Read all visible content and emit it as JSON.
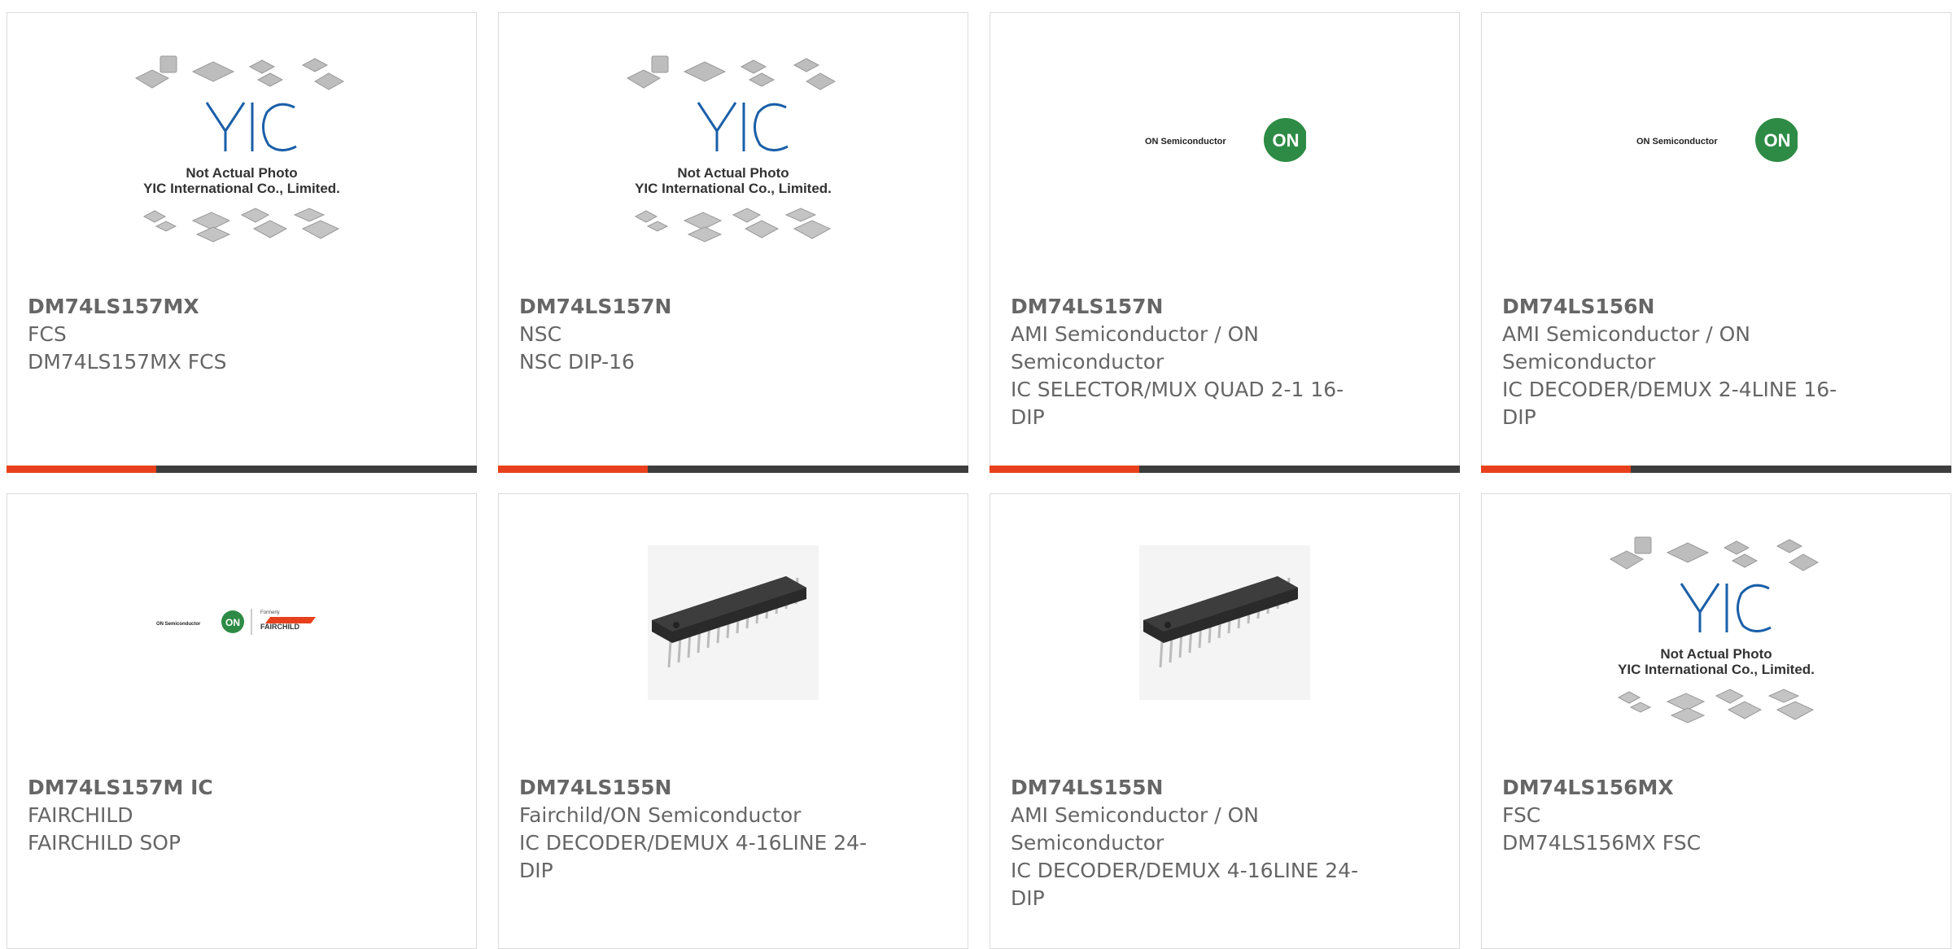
{
  "accent_color": "#e8401c",
  "bar_color": "#3d3d3d",
  "products": [
    {
      "part": "DM74LS157MX",
      "maker": "FCS",
      "desc": "DM74LS157MX FCS",
      "image": "yic-placeholder",
      "yic_line1": "Not Actual Photo",
      "yic_line2": "YIC International Co., Limited."
    },
    {
      "part": "DM74LS157N",
      "maker": "NSC",
      "desc": "NSC DIP-16",
      "image": "yic-placeholder",
      "yic_line1": "Not Actual Photo",
      "yic_line2": "YIC International Co., Limited."
    },
    {
      "part": "DM74LS157N",
      "maker": "AMI Semiconductor / ON Semiconductor",
      "desc": "IC SELECTOR/MUX QUAD 2-1 16-DIP",
      "image": "on-semi-logo",
      "logo_text": "ON Semiconductor",
      "logo_badge": "ON"
    },
    {
      "part": "DM74LS156N",
      "maker": "AMI Semiconductor / ON Semiconductor",
      "desc": "IC DECODER/DEMUX 2-4LINE 16-DIP",
      "image": "on-semi-logo",
      "logo_text": "ON Semiconductor",
      "logo_badge": "ON"
    },
    {
      "part": "DM74LS157M IC",
      "maker": "FAIRCHILD",
      "desc": "FAIRCHILD SOP",
      "image": "on-fairchild-logo",
      "logo_text": "ON Semiconductor",
      "logo_badge": "ON",
      "formerly": "Formerly",
      "fairchild": "FAIRCHILD"
    },
    {
      "part": "DM74LS155N",
      "maker": "Fairchild/ON Semiconductor",
      "desc": "IC DECODER/DEMUX 4-16LINE 24-DIP",
      "image": "dip-chip-photo"
    },
    {
      "part": "DM74LS155N",
      "maker": "AMI Semiconductor / ON Semiconductor",
      "desc": "IC DECODER/DEMUX 4-16LINE 24-DIP",
      "image": "dip-chip-photo"
    },
    {
      "part": "DM74LS156MX",
      "maker": "FSC",
      "desc": "DM74LS156MX FSC",
      "image": "yic-placeholder",
      "yic_line1": "Not Actual Photo",
      "yic_line2": "YIC International Co., Limited."
    }
  ]
}
